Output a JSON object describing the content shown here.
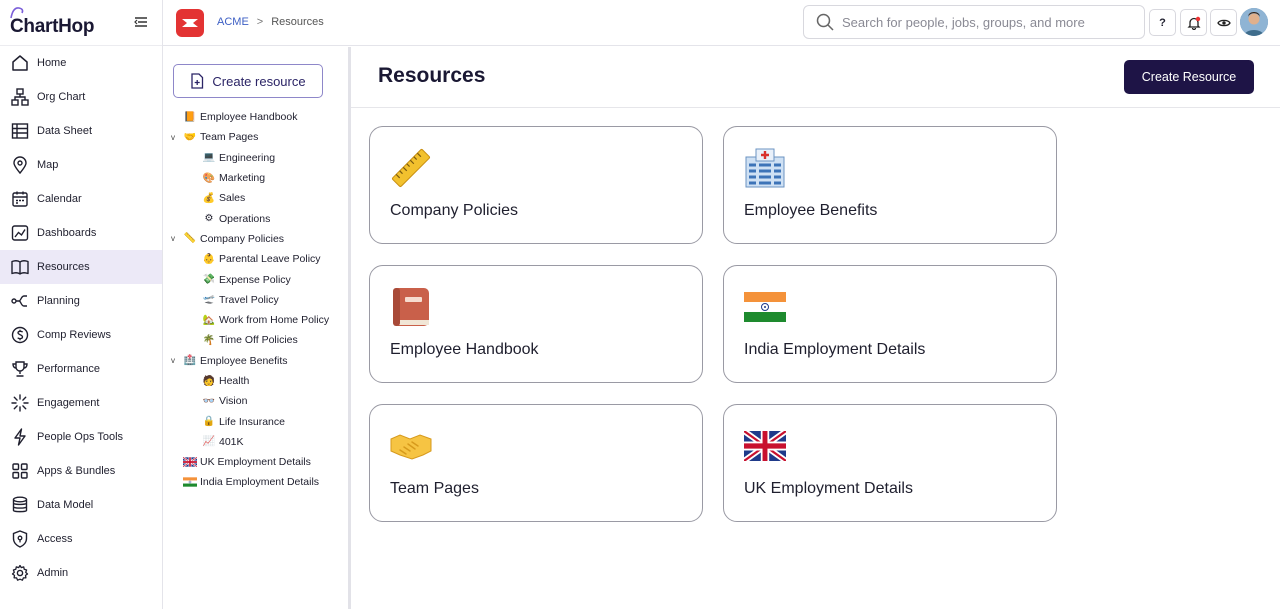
{
  "app": {
    "logo_text": "ChartHop"
  },
  "nav": {
    "items": [
      {
        "label": "Home",
        "icon": "home-icon"
      },
      {
        "label": "Org Chart",
        "icon": "org-chart-icon"
      },
      {
        "label": "Data Sheet",
        "icon": "data-sheet-icon"
      },
      {
        "label": "Map",
        "icon": "map-pin-icon"
      },
      {
        "label": "Calendar",
        "icon": "calendar-icon"
      },
      {
        "label": "Dashboards",
        "icon": "dashboard-icon"
      },
      {
        "label": "Resources",
        "icon": "book-icon",
        "active": true
      },
      {
        "label": "Planning",
        "icon": "planning-icon"
      },
      {
        "label": "Comp Reviews",
        "icon": "dollar-icon"
      },
      {
        "label": "Performance",
        "icon": "trophy-icon"
      },
      {
        "label": "Engagement",
        "icon": "sparkle-icon"
      },
      {
        "label": "People Ops Tools",
        "icon": "lightning-icon"
      },
      {
        "label": "Apps & Bundles",
        "icon": "apps-icon"
      },
      {
        "label": "Data Model",
        "icon": "database-icon"
      },
      {
        "label": "Access",
        "icon": "shield-icon"
      },
      {
        "label": "Admin",
        "icon": "gear-icon"
      }
    ]
  },
  "header": {
    "breadcrumb": {
      "org": "ACME",
      "separator": ">",
      "current": "Resources"
    },
    "search_placeholder": "Search for people, jobs, groups, and more",
    "help_label": "?"
  },
  "tree_panel": {
    "create_label": "Create resource",
    "items": [
      {
        "label": "Employee Handbook",
        "level": 0,
        "caret": "",
        "icon": "📙"
      },
      {
        "label": "Team Pages",
        "level": 0,
        "caret": "v",
        "icon": "🤝"
      },
      {
        "label": "Engineering",
        "level": 1,
        "caret": "",
        "icon": "💻"
      },
      {
        "label": "Marketing",
        "level": 1,
        "caret": "",
        "icon": "🎨"
      },
      {
        "label": "Sales",
        "level": 1,
        "caret": "",
        "icon": "💰"
      },
      {
        "label": "Operations",
        "level": 1,
        "caret": "",
        "icon": "⚙"
      },
      {
        "label": "Company Policies",
        "level": 0,
        "caret": "v",
        "icon": "📏"
      },
      {
        "label": "Parental Leave Policy",
        "level": 1,
        "caret": "",
        "icon": "👶"
      },
      {
        "label": "Expense Policy",
        "level": 1,
        "caret": "",
        "icon": "💸"
      },
      {
        "label": "Travel Policy",
        "level": 1,
        "caret": "",
        "icon": "🛫"
      },
      {
        "label": "Work from Home Policy",
        "level": 1,
        "caret": "",
        "icon": "🏡"
      },
      {
        "label": "Time Off Policies",
        "level": 1,
        "caret": "",
        "icon": "🌴"
      },
      {
        "label": "Employee Benefits",
        "level": 0,
        "caret": "v",
        "icon": "🏥"
      },
      {
        "label": "Health",
        "level": 1,
        "caret": "",
        "icon": "🧑"
      },
      {
        "label": "Vision",
        "level": 1,
        "caret": "",
        "icon": "👓"
      },
      {
        "label": "Life Insurance",
        "level": 1,
        "caret": "",
        "icon": "🔒"
      },
      {
        "label": "401K",
        "level": 1,
        "caret": "",
        "icon": "📈"
      },
      {
        "label": "UK Employment Details",
        "level": 0,
        "caret": "",
        "icon": "uk-flag"
      },
      {
        "label": "India Employment Details",
        "level": 0,
        "caret": "",
        "icon": "india-flag"
      }
    ]
  },
  "main": {
    "title": "Resources",
    "create_button": "Create Resource",
    "cards": [
      {
        "label": "Company Policies",
        "icon": "ruler-icon"
      },
      {
        "label": "Employee Benefits",
        "icon": "hospital-icon"
      },
      {
        "label": "Employee Handbook",
        "icon": "book-icon"
      },
      {
        "label": "India Employment Details",
        "icon": "india-flag-icon"
      },
      {
        "label": "Team Pages",
        "icon": "handshake-icon"
      },
      {
        "label": "UK Employment Details",
        "icon": "uk-flag-icon"
      }
    ]
  },
  "colors": {
    "accent": "#1e1446",
    "active_nav_bg": "#ece9f7",
    "acme_red": "#e33333",
    "link": "#3d5fc4"
  }
}
